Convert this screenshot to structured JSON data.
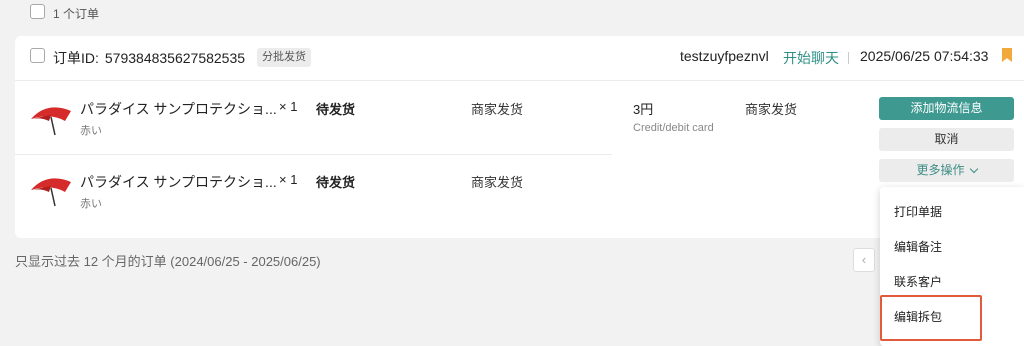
{
  "header": {
    "selected_count_label": "1 个订单"
  },
  "order": {
    "id_label": "订单ID:",
    "id_value": "579384835627582535",
    "tag": "分批发货",
    "buyer": "testzuyfpeznvl",
    "chat_label": "开始聊天",
    "datetime": "2025/06/25 07:54:33",
    "bookmark_color": "#f0a93a",
    "items": [
      {
        "image_icon": "red-umbrella-image",
        "name": "パラダイス サンプロテクショ...",
        "variant": "赤い",
        "quantity": "× 1",
        "status": "待发货",
        "shipping": "商家发货"
      },
      {
        "image_icon": "red-umbrella-image",
        "name": "パラダイス サンプロテクショ...",
        "variant": "赤い",
        "quantity": "× 1",
        "status": "待发货",
        "shipping": "商家发货"
      }
    ],
    "price": "3円",
    "payment_method": "Credit/debit card",
    "fulfillment": "商家发货",
    "actions": {
      "primary": "添加物流信息",
      "cancel": "取消",
      "more": "更多操作"
    },
    "more_menu": [
      "打印单据",
      "编辑备注",
      "联系客户",
      "编辑拆包"
    ]
  },
  "footer": {
    "note": "只显示过去 12 个月的订单 (2024/06/25 - 2025/06/25)"
  },
  "pagination": {
    "prev_icon": "chevron-left-icon",
    "prev_symbol": "‹"
  },
  "colors": {
    "accent": "#3e9a91",
    "highlight": "#e05a3c"
  }
}
